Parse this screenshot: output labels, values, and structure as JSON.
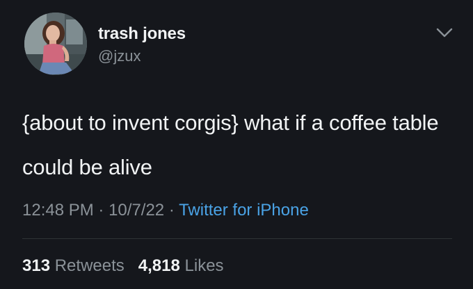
{
  "user": {
    "display_name": "trash jones",
    "handle": "@jzux",
    "avatar": "profile-photo"
  },
  "tweet": {
    "text": "{about to invent corgis} what if a coffee table could be alive",
    "time": "12:48 PM",
    "date": "10/7/22",
    "separator": "·",
    "source": "Twitter for iPhone"
  },
  "stats": {
    "retweets_count": "313",
    "retweets_label": "Retweets",
    "likes_count": "4,818",
    "likes_label": "Likes"
  },
  "icons": {
    "menu": "chevron-down-icon"
  },
  "colors": {
    "background": "#15171c",
    "link": "#4aa3e6",
    "secondary_text": "#8b9298"
  }
}
